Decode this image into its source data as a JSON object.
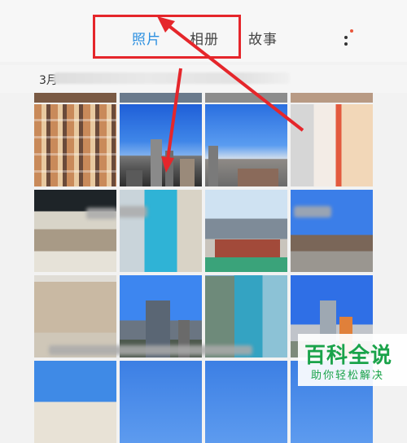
{
  "header": {
    "tabs": [
      {
        "label": "照片",
        "active": true
      },
      {
        "label": "相册",
        "active": false
      },
      {
        "label": "故事",
        "active": false
      }
    ],
    "more_icon": "more-vertical-dots-icon",
    "accent_color": "#2b8fe0",
    "notification_dot_color": "#e9563b"
  },
  "section": {
    "date_label": "3月"
  },
  "annotation": {
    "highlight_color": "#e5262b",
    "arrow_color": "#e5262b"
  },
  "watermark": {
    "logo_text": "百科全说",
    "subtitle": "助你轻松解决"
  },
  "photos": [
    "store-shelves",
    "sky-towers",
    "sky-plaza",
    "poster-ad",
    "green-party-store",
    "cyan-banner",
    "tower-block",
    "street-gate",
    "old-building",
    "city-skyline",
    "mural-wall",
    "tall-tower",
    "dome",
    "blue-sky-1",
    "blue-sky-2",
    "blue-sky-3"
  ]
}
